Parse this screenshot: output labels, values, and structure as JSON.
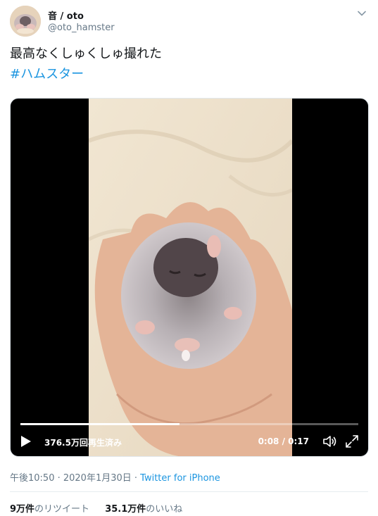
{
  "header": {
    "display_name": "音 / oto",
    "handle": "@oto_hamster"
  },
  "tweet": {
    "text": "最高なくしゅくしゅ撮れた",
    "hashtag": "#ハムスター"
  },
  "video": {
    "views": "376.5万回再生済み",
    "time": "0:08 / 0:17",
    "progress": 0.47
  },
  "meta": {
    "timestamp": "午後10:50 · 2020年1月30日 ·",
    "source": "Twitter for iPhone"
  },
  "stats": {
    "retweets_count": "9万件",
    "retweets_label": "のリツイート",
    "likes_count": "35.1万件",
    "likes_label": "のいいね"
  },
  "colors": {
    "link": "#1b95e0",
    "secondary_text": "#657786",
    "video_bg": "#000000"
  }
}
